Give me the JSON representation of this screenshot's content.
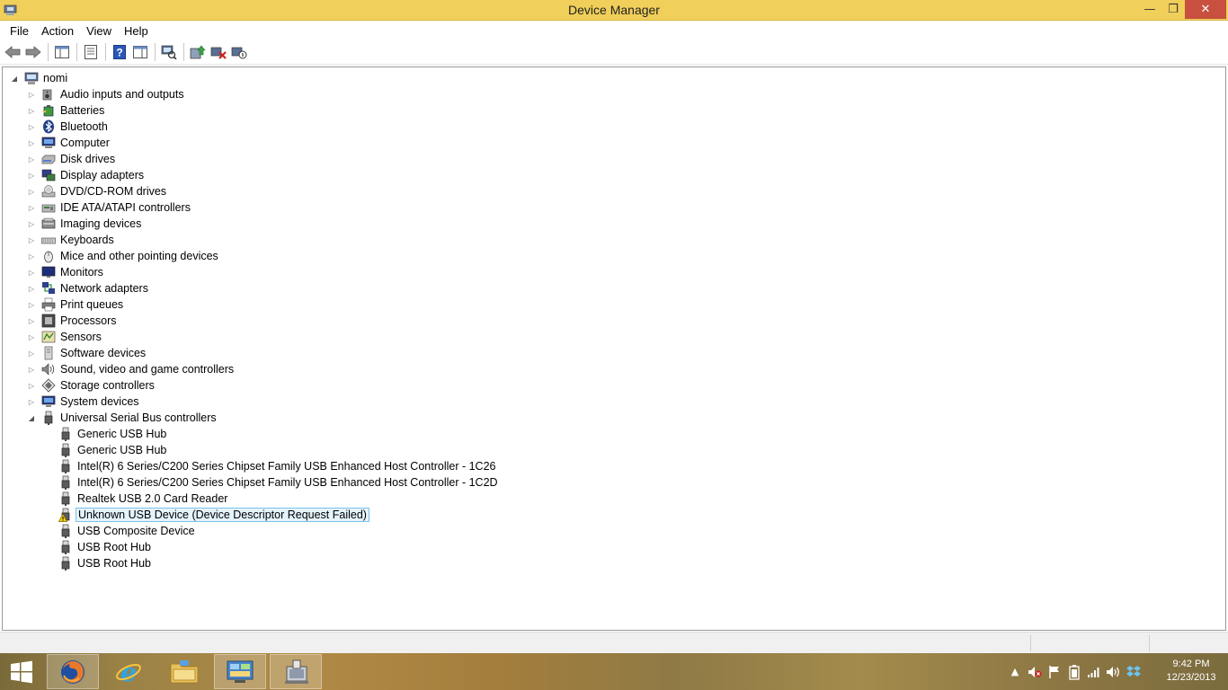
{
  "window": {
    "title": "Device Manager",
    "minimize_glyph": "—",
    "maximize_glyph": "❐",
    "close_glyph": "✕"
  },
  "menu": [
    "File",
    "Action",
    "View",
    "Help"
  ],
  "toolbar": {
    "icons": [
      "back-arrow-icon",
      "forward-arrow-icon",
      "show-hide-console-tree-icon",
      "properties-icon",
      "help-icon",
      "action-pane-icon",
      "scan-hardware-changes-icon",
      "update-driver-icon",
      "uninstall-device-icon",
      "disable-device-icon"
    ]
  },
  "tree": {
    "root": "nomi",
    "categories": [
      {
        "label": "Audio inputs and outputs",
        "icon": "speaker-icon"
      },
      {
        "label": "Batteries",
        "icon": "battery-icon"
      },
      {
        "label": "Bluetooth",
        "icon": "bluetooth-icon"
      },
      {
        "label": "Computer",
        "icon": "computer-icon"
      },
      {
        "label": "Disk drives",
        "icon": "disk-drive-icon"
      },
      {
        "label": "Display adapters",
        "icon": "display-adapter-icon"
      },
      {
        "label": "DVD/CD-ROM drives",
        "icon": "dvd-drive-icon"
      },
      {
        "label": "IDE ATA/ATAPI controllers",
        "icon": "ide-controller-icon"
      },
      {
        "label": "Imaging devices",
        "icon": "imaging-device-icon"
      },
      {
        "label": "Keyboards",
        "icon": "keyboard-icon"
      },
      {
        "label": "Mice and other pointing devices",
        "icon": "mouse-icon"
      },
      {
        "label": "Monitors",
        "icon": "monitor-icon"
      },
      {
        "label": "Network adapters",
        "icon": "network-adapter-icon"
      },
      {
        "label": "Print queues",
        "icon": "printer-icon"
      },
      {
        "label": "Processors",
        "icon": "processor-icon"
      },
      {
        "label": "Sensors",
        "icon": "sensor-icon"
      },
      {
        "label": "Software devices",
        "icon": "software-device-icon"
      },
      {
        "label": "Sound, video and game controllers",
        "icon": "sound-controller-icon"
      },
      {
        "label": "Storage controllers",
        "icon": "storage-controller-icon"
      },
      {
        "label": "System devices",
        "icon": "system-device-icon"
      },
      {
        "label": "Universal Serial Bus controllers",
        "icon": "usb-icon",
        "expanded": true
      }
    ],
    "usb_children": [
      {
        "label": "Generic USB Hub",
        "warning": false
      },
      {
        "label": "Generic USB Hub",
        "warning": false
      },
      {
        "label": "Intel(R) 6 Series/C200 Series Chipset Family USB Enhanced Host Controller - 1C26",
        "warning": false
      },
      {
        "label": "Intel(R) 6 Series/C200 Series Chipset Family USB Enhanced Host Controller - 1C2D",
        "warning": false
      },
      {
        "label": "Realtek USB 2.0 Card Reader",
        "warning": false
      },
      {
        "label": "Unknown USB Device (Device Descriptor Request Failed)",
        "warning": true,
        "selected": true
      },
      {
        "label": "USB Composite Device",
        "warning": false
      },
      {
        "label": "USB Root Hub",
        "warning": false
      },
      {
        "label": "USB Root Hub",
        "warning": false
      }
    ]
  },
  "taskbar": {
    "apps": [
      "firefox-icon",
      "internet-explorer-icon",
      "file-explorer-icon",
      "control-panel-icon",
      "device-manager-icon"
    ],
    "active_app": "device-manager-icon"
  },
  "tray": {
    "icons": [
      "show-hidden-icons-icon",
      "speaker-muted-icon",
      "flag-icon",
      "battery-tray-icon",
      "network-signal-icon",
      "volume-icon",
      "dropbox-icon"
    ]
  },
  "clock": {
    "time": "9:42 PM",
    "date": "12/23/2013"
  },
  "colors": {
    "titlebar": "#f0cf5a",
    "close_button": "#c7503e",
    "selection_fill": "#e5f3fb",
    "selection_border": "#7ac1e8"
  }
}
